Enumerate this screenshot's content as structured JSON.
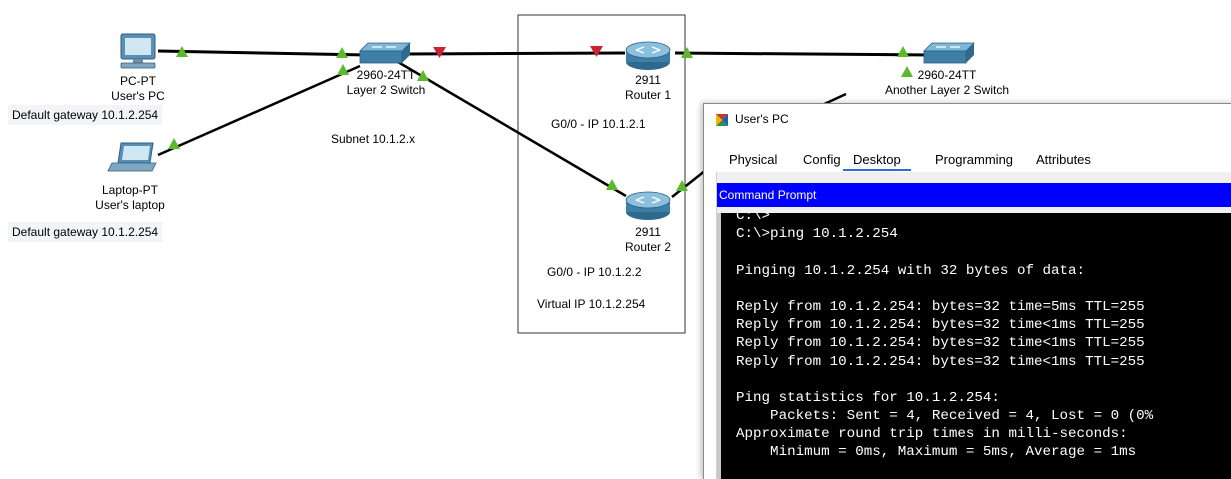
{
  "devices": {
    "pc": {
      "model": "PC-PT",
      "name": "User's PC",
      "icon": "pc-icon"
    },
    "laptop": {
      "model": "Laptop-PT",
      "name": "User's laptop",
      "icon": "laptop-icon"
    },
    "switch1": {
      "model": "2960-24TT",
      "name": "Layer 2 Switch",
      "icon": "switch-icon"
    },
    "router1": {
      "model": "2911",
      "name": "Router 1",
      "icon": "router-icon"
    },
    "router2": {
      "model": "2911",
      "name": "Router 2",
      "icon": "router-icon"
    },
    "switch2": {
      "model": "2960-24TT",
      "name": "Another Layer 2 Switch",
      "icon": "switch-icon"
    }
  },
  "notes": {
    "pc_gateway": "Default gateway 10.1.2.254",
    "laptop_gateway": "Default gateway 10.1.2.254",
    "subnet": "Subnet 10.1.2.x",
    "router1_ip": "G0/0 - IP 10.1.2.1",
    "router2_ip": "G0/0 - IP 10.1.2.2",
    "virtual_ip": "Virtual IP 10.1.2.254"
  },
  "colors": {
    "link_up": "#5cb82c",
    "link_blocked": "#cc2233",
    "device_blue": "#3d7fa6",
    "cmd_header": "#0000ff"
  },
  "dialog": {
    "title": "User's PC",
    "tabs": [
      "Physical",
      "Config",
      "Desktop",
      "Programming",
      "Attributes"
    ],
    "active_tab": "Desktop",
    "panel_title": "Command Prompt",
    "console_lines": [
      "C:\\>",
      "C:\\>ping 10.1.2.254",
      "",
      "Pinging 10.1.2.254 with 32 bytes of data:",
      "",
      "Reply from 10.1.2.254: bytes=32 time=5ms TTL=255",
      "Reply from 10.1.2.254: bytes=32 time<1ms TTL=255",
      "Reply from 10.1.2.254: bytes=32 time<1ms TTL=255",
      "Reply from 10.1.2.254: bytes=32 time<1ms TTL=255",
      "",
      "Ping statistics for 10.1.2.254:",
      "    Packets: Sent = 4, Received = 4, Lost = 0 (0%",
      "Approximate round trip times in milli-seconds:",
      "    Minimum = 0ms, Maximum = 5ms, Average = 1ms"
    ]
  }
}
